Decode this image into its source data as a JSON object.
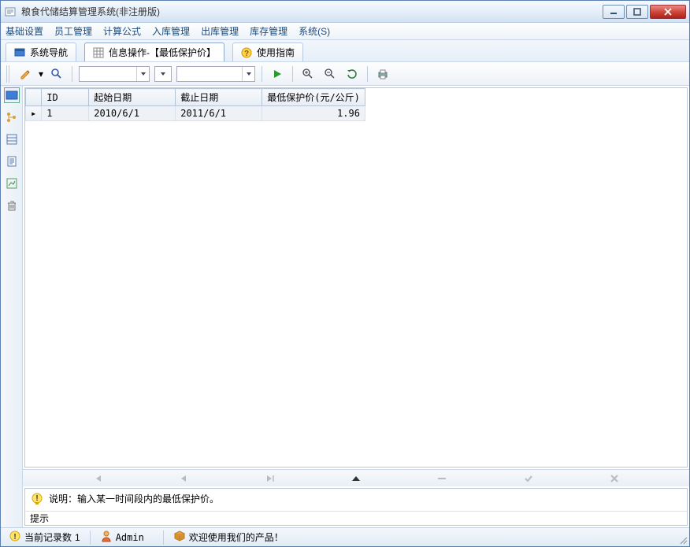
{
  "title": "粮食代储结算管理系统(非注册版)",
  "menu": [
    "基础设置",
    "员工管理",
    "计算公式",
    "入库管理",
    "出库管理",
    "库存管理",
    "系统(S)"
  ],
  "tabs": [
    {
      "label": "系统导航",
      "icon": "window-icon"
    },
    {
      "label": "信息操作-【最低保护价】",
      "icon": "grid-icon",
      "active": true
    },
    {
      "label": "使用指南",
      "icon": "help-icon"
    }
  ],
  "toolbar": {
    "edit_icon": "pencil-icon",
    "find_icon": "find-icon",
    "run_icon": "play-icon",
    "zoomin_icon": "zoom-in-icon",
    "zoomout_icon": "zoom-out-icon",
    "refresh_icon": "refresh-icon",
    "print_icon": "print-icon"
  },
  "grid": {
    "columns": [
      "ID",
      "起始日期",
      "截止日期",
      "最低保护价(元/公斤)"
    ],
    "rows": [
      {
        "id": "1",
        "start": "2010/6/1",
        "end": "2011/6/1",
        "price": "1.96"
      }
    ]
  },
  "navigator": {
    "first": "|◂",
    "prev": "◂",
    "next": "▶|",
    "add": "▲",
    "del": "−",
    "edit": "✓",
    "cancel": "✗"
  },
  "hint": {
    "label": "说明：",
    "text": "输入某一时间段内的最低保护价。",
    "tab": "提示"
  },
  "status": {
    "records_label": "当前记录数",
    "records_value": "1",
    "user": "Admin",
    "welcome": "欢迎使用我们的产品！"
  }
}
